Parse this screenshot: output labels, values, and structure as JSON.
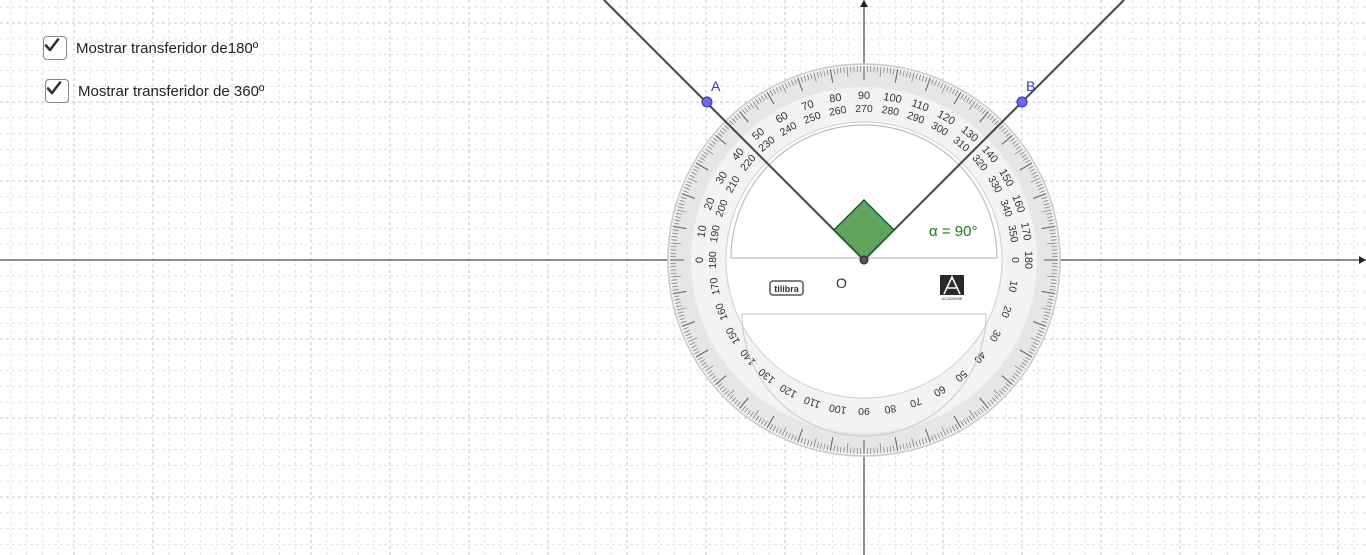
{
  "checkboxes": [
    {
      "label": "Mostrar transferidor de180º",
      "checked": true
    },
    {
      "label": "Mostrar transferidor de 360º",
      "checked": true
    }
  ],
  "points": {
    "a": "A",
    "b": "B",
    "o": "O"
  },
  "angle": {
    "label": "α = 90°",
    "value_degrees": 90,
    "color": "#1a7a1a",
    "fill": "#5fa35f"
  },
  "protractor": {
    "brand_left": "tilibra",
    "brand_right_logo": "ACADEMIE"
  },
  "colors": {
    "grid": "#c8c8c8",
    "axis": "#222222",
    "lines": "#444444",
    "point_fill": "#6a6ae6",
    "point_label": "#3535c8",
    "protractor_ring": "#d6d6d6"
  }
}
